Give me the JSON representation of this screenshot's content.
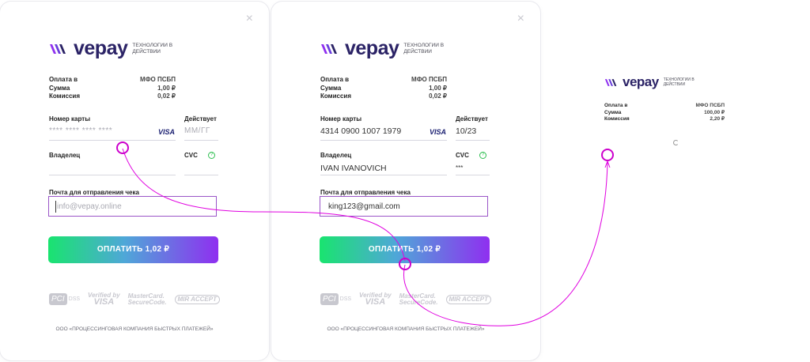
{
  "brand": {
    "name": "vepay",
    "tagline": "ТЕХНОЛОГИИ В ДЕЙСТВИИ"
  },
  "close_symbol": "×",
  "labels": {
    "payment_to": "Оплата в",
    "amount": "Сумма",
    "fee": "Комиссия",
    "card_number": "Номер карты",
    "valid_thru": "Действует",
    "holder": "Владелец",
    "cvc": "CVC",
    "receipt_email": "Почта для отправления чека",
    "cvc_help": "?"
  },
  "card_brand": "VISA",
  "badges": {
    "pci": "PCI",
    "dss": "DSS",
    "verified": "Verified by",
    "visa": "VISA",
    "mastercard": "MasterCard.",
    "securecode": "SecureCode.",
    "mir": "MIR ACCEPT"
  },
  "footer": "ООО «ПРОЦЕССИНГОВАЯ КОМПАНИЯ БЫСТРЫХ ПЛАТЕЖЕЙ»",
  "panel1": {
    "merchant": "МФО ПСБП",
    "amount": "1,00 ₽",
    "fee": "0,02 ₽",
    "card_placeholder": "**** **** **** ****",
    "expiry_placeholder": "ММ/ГГ",
    "email_placeholder": "info@vepay.online",
    "pay_label": "ОПЛАТИТЬ 1,02 ₽"
  },
  "panel2": {
    "merchant": "МФО ПСБП",
    "amount": "1,00 ₽",
    "fee": "0,02 ₽",
    "card_number": "4314 0900 1007 1979",
    "expiry": "10/23",
    "holder": "IVAN IVANOVICH",
    "cvc": "***",
    "email": "king123@gmail.com",
    "pay_label": "ОПЛАТИТЬ 1,02 ₽"
  },
  "panel3": {
    "merchant": "МФО ПСБП",
    "amount": "100,00 ₽",
    "fee": "2,20 ₽"
  },
  "colors": {
    "brand_purple": "#2b2366",
    "accent_magenta": "#e000e0",
    "btn_gradient_start": "#19e46f",
    "btn_gradient_end": "#8f2ff0"
  }
}
